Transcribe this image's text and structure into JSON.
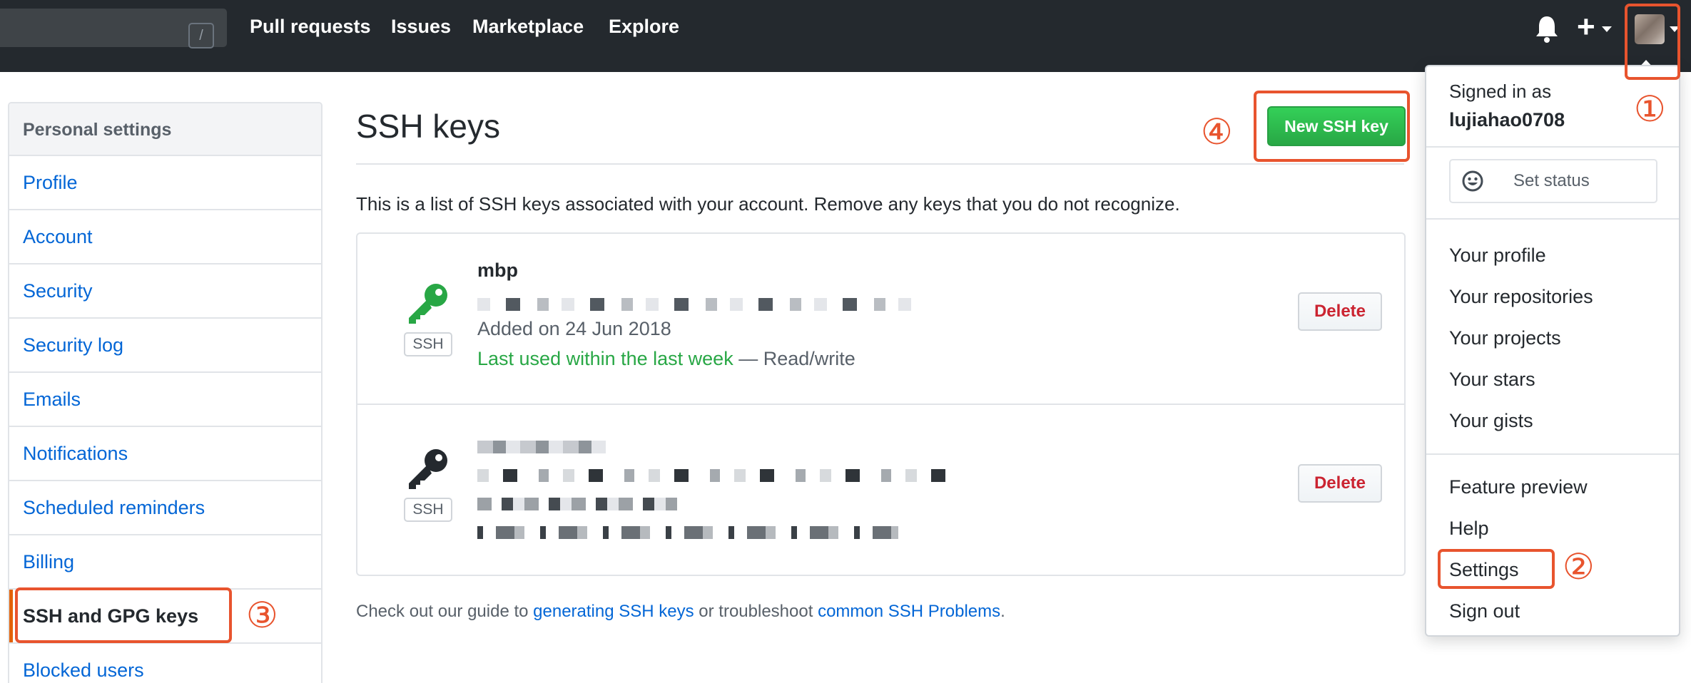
{
  "header": {
    "search_hint": "/",
    "nav": [
      "Pull requests",
      "Issues",
      "Marketplace",
      "Explore"
    ],
    "icons": [
      "bell-icon",
      "plus-icon",
      "avatar"
    ]
  },
  "sidebar": {
    "heading": "Personal settings",
    "items": [
      {
        "label": "Profile"
      },
      {
        "label": "Account"
      },
      {
        "label": "Security"
      },
      {
        "label": "Security log"
      },
      {
        "label": "Emails"
      },
      {
        "label": "Notifications"
      },
      {
        "label": "Scheduled reminders"
      },
      {
        "label": "Billing"
      },
      {
        "label": "SSH and GPG keys",
        "selected": true
      },
      {
        "label": "Blocked users"
      }
    ]
  },
  "main": {
    "title": "SSH keys",
    "new_key_button": "New SSH key",
    "intro": "This is a list of SSH keys associated with your account. Remove any keys that you do not recognize.",
    "keys": [
      {
        "name": "mbp",
        "badge": "SSH",
        "added": "Added on 24 Jun 2018",
        "last_used": "Last used within the last week",
        "access": "— Read/write",
        "delete_label": "Delete",
        "icon_color": "#28a745"
      },
      {
        "badge": "SSH",
        "delete_label": "Delete",
        "icon_color": "#24292e"
      }
    ],
    "footer": {
      "prefix": "Check out our guide to ",
      "link1": "generating SSH keys",
      "middle": " or troubleshoot ",
      "link2": "common SSH Problems",
      "suffix": "."
    }
  },
  "dropdown": {
    "signed_in_as": "Signed in as",
    "username": "lujiahao0708",
    "set_status": "Set status",
    "group1": [
      "Your profile",
      "Your repositories",
      "Your projects",
      "Your stars",
      "Your gists"
    ],
    "group2": [
      "Feature preview",
      "Help",
      "Settings",
      "Sign out"
    ]
  },
  "annotations": [
    "①",
    "②",
    "③",
    "④"
  ],
  "colors": {
    "header_bg": "#24292e",
    "link": "#0366d6",
    "primary_button": "#28a745",
    "danger": "#cb2431",
    "annotation": "#e8542e",
    "selected_marker": "#e36209"
  }
}
